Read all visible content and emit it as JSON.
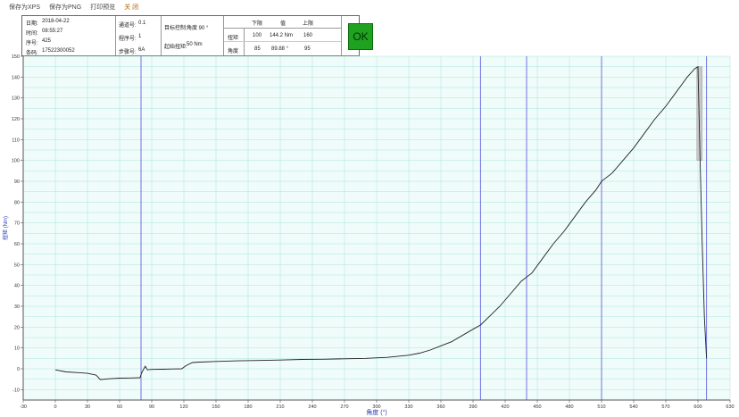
{
  "menu": [
    "保存为XPS",
    "保存为PNG",
    "打印预览",
    "关 闭"
  ],
  "info": {
    "date_label": "日期:",
    "date_value": "2018-04-22",
    "time_label": "时间:",
    "time_value": "08:55:27",
    "seq_label": "序号:",
    "seq_value": "425",
    "barcode_label": "条码:",
    "barcode_value": "17522300052",
    "channel_label": "通道号:",
    "channel_value": "0.1",
    "program_label": "程序号:",
    "program_value": "1",
    "step_label": "步骤号:",
    "step_value": "6A",
    "target_label": "目标控制:",
    "target_value": "角度 90 °",
    "threshold_label": "起始扭矩:",
    "threshold_value": "50 Nm",
    "table_headers": [
      "下限",
      "值",
      "上限"
    ],
    "torque_label": "扭矩",
    "torque_low": "100",
    "torque_value": "144.2 Nm",
    "torque_high": "160",
    "angle_label": "角度",
    "angle_low": "85",
    "angle_value": "89.88 °",
    "angle_high": "95",
    "status": "OK"
  },
  "colors": {
    "plot_bg": "#effcf9",
    "grid": "#aee4df",
    "curve": "#222222",
    "marker": "#6f6fe6",
    "highlight": "#c8c8c8",
    "status_green": "#1fa21f",
    "axis_label": "#2a3eb0"
  },
  "chart_data": {
    "type": "line",
    "xlabel": "角度 (°)",
    "ylabel": "扭矩 (Nm)",
    "xlim": [
      -30,
      630
    ],
    "ylim": [
      -15,
      150
    ],
    "xticks": [
      -30,
      0,
      30,
      60,
      90,
      120,
      150,
      180,
      210,
      240,
      270,
      300,
      330,
      360,
      390,
      420,
      450,
      480,
      510,
      540,
      570,
      600,
      630
    ],
    "yticks": [
      -10,
      -5,
      0,
      5,
      10,
      15,
      20,
      25,
      30,
      35,
      40,
      45,
      50,
      55,
      60,
      65,
      70,
      75,
      80,
      85,
      90,
      95,
      100,
      105,
      110,
      115,
      120,
      125,
      130,
      135,
      140,
      145,
      150
    ],
    "ytick_labels": [
      -10,
      0,
      10,
      20,
      30,
      40,
      50,
      60,
      70,
      80,
      90,
      100,
      110,
      120,
      130,
      140,
      150
    ],
    "grid": true,
    "vertical_markers": [
      80,
      397,
      440,
      510,
      608
    ],
    "highlight_band": {
      "x": [
        599,
        604
      ],
      "y": [
        100,
        145
      ]
    },
    "series": [
      {
        "x": [
          0,
          10,
          20,
          30,
          38,
          42,
          50,
          60,
          70,
          79,
          81,
          84,
          86,
          90,
          100,
          110,
          118,
          122,
          128,
          135,
          150,
          170,
          190,
          210,
          230,
          250,
          270,
          290,
          310,
          330,
          340,
          350,
          360,
          370,
          380,
          390,
          397,
          405,
          415,
          425,
          435,
          440,
          445,
          455,
          465,
          475,
          485,
          495,
          505,
          510,
          520,
          530,
          540,
          550,
          560,
          570,
          580,
          590,
          597,
          600,
          602,
          604,
          606,
          608
        ],
        "y": [
          -0.5,
          -1.5,
          -1.8,
          -2.2,
          -3,
          -5.2,
          -4.8,
          -4.5,
          -4.4,
          -4.3,
          -1.5,
          1.2,
          -0.5,
          -0.3,
          -0.2,
          -0.1,
          0,
          1.5,
          3,
          3.2,
          3.5,
          3.8,
          4,
          4.2,
          4.5,
          4.6,
          4.8,
          5,
          5.5,
          6.5,
          7.5,
          9,
          11,
          13,
          16,
          19,
          21,
          25,
          30,
          36,
          42,
          44,
          46,
          53,
          60,
          66,
          73,
          80,
          86,
          90,
          94,
          100,
          106,
          113,
          120,
          126,
          133,
          140,
          144,
          145,
          100,
          60,
          25,
          5
        ]
      }
    ]
  }
}
